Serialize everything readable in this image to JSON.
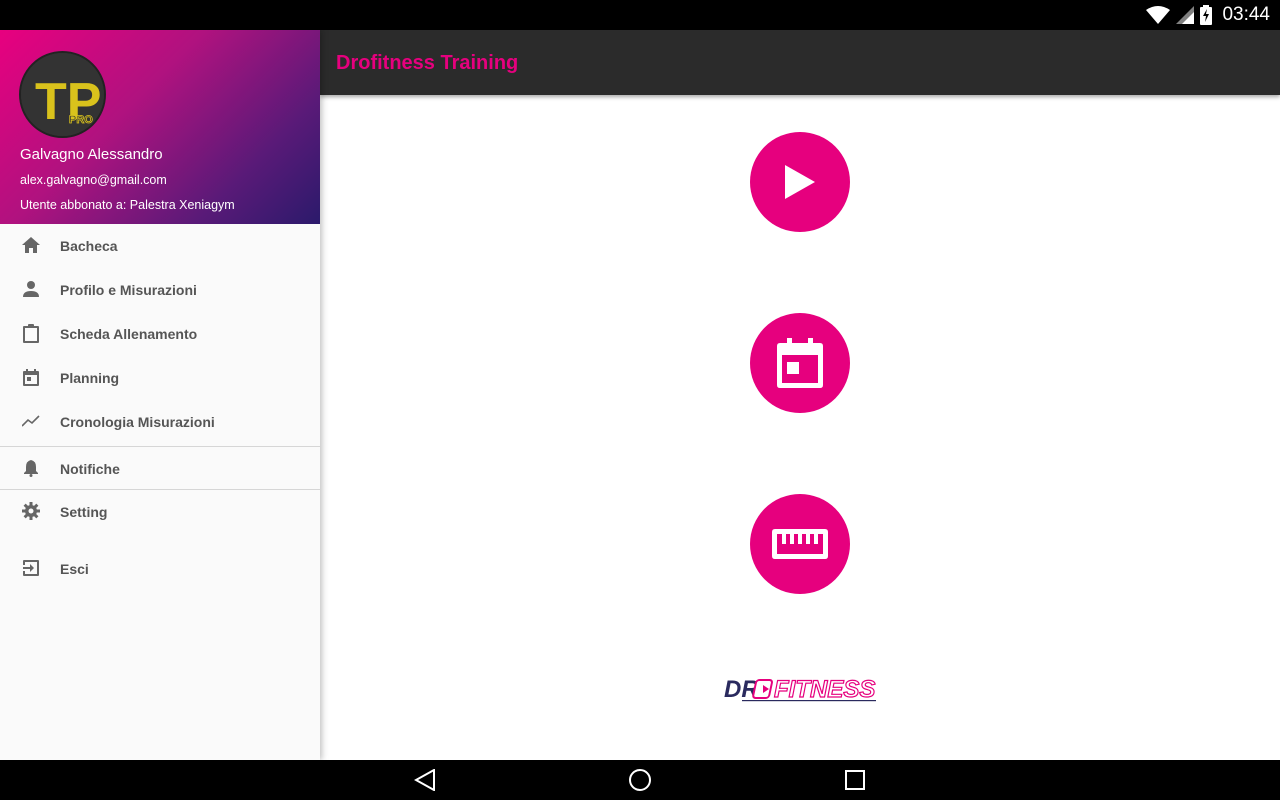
{
  "status_bar": {
    "time": "03:44",
    "icons": [
      "wifi-icon",
      "cell-signal-icon",
      "battery-charging-icon"
    ]
  },
  "toolbar": {
    "title": "Drofitness Training"
  },
  "drawer": {
    "avatar_text": "TP",
    "avatar_subtext": "PRO",
    "user_name": "Galvagno Alessandro",
    "user_email": "alex.galvagno@gmail.com",
    "user_gym": "Utente abbonato a: Palestra Xeniagym",
    "items": [
      {
        "label": "Bacheca",
        "icon": "home-icon"
      },
      {
        "label": "Profilo e Misurazioni",
        "icon": "person-icon"
      },
      {
        "label": "Scheda Allenamento",
        "icon": "clipboard-icon"
      },
      {
        "label": "Planning",
        "icon": "calendar-icon"
      },
      {
        "label": "Cronologia Misurazioni",
        "icon": "trending-icon"
      },
      {
        "label": "Notifiche",
        "icon": "bell-icon"
      },
      {
        "label": "Setting",
        "icon": "gear-icon"
      },
      {
        "label": "Esci",
        "icon": "exit-icon"
      }
    ]
  },
  "main": {
    "buttons": [
      "play-icon",
      "calendar-icon",
      "ruler-icon"
    ],
    "logo_text_left": "DR",
    "logo_text_right": "FITNESS"
  },
  "colors": {
    "accent": "#e6007e",
    "toolbar_bg": "#2b2b2b",
    "drawer_bg": "#fafafa",
    "logo_navy": "#2a2a5e"
  },
  "nav_bar": {
    "buttons": [
      "back-icon",
      "home-circle-icon",
      "recents-icon"
    ]
  }
}
